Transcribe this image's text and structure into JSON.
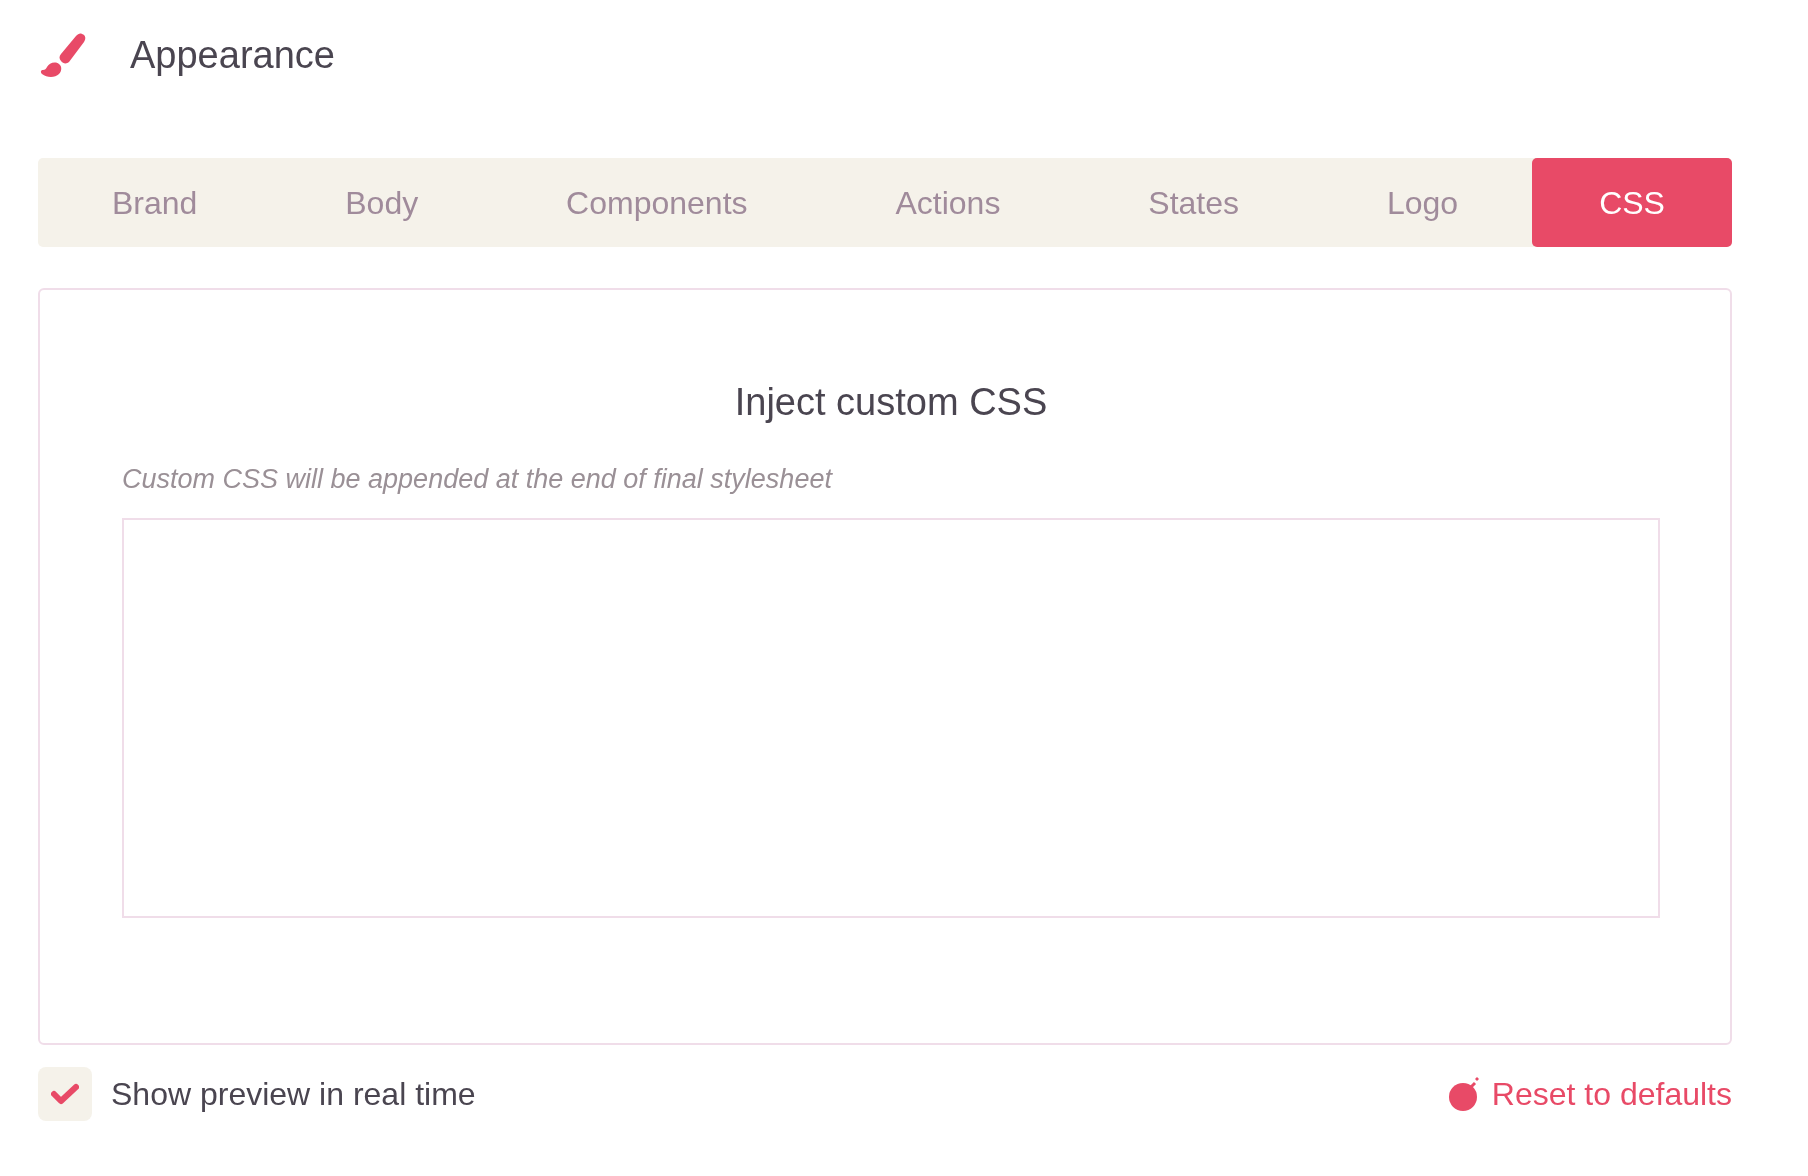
{
  "header": {
    "title": "Appearance"
  },
  "tabs": [
    {
      "label": "Brand",
      "selected": false
    },
    {
      "label": "Body",
      "selected": false
    },
    {
      "label": "Components",
      "selected": false
    },
    {
      "label": "Actions",
      "selected": false
    },
    {
      "label": "States",
      "selected": false
    },
    {
      "label": "Logo",
      "selected": false
    },
    {
      "label": "CSS",
      "selected": true
    }
  ],
  "panel": {
    "heading": "Inject custom CSS",
    "hint": "Custom CSS will be appended at the end of final stylesheet"
  },
  "preview": {
    "label": "Show preview in real time",
    "checked": true
  },
  "reset": {
    "label": "Reset to defaults"
  }
}
